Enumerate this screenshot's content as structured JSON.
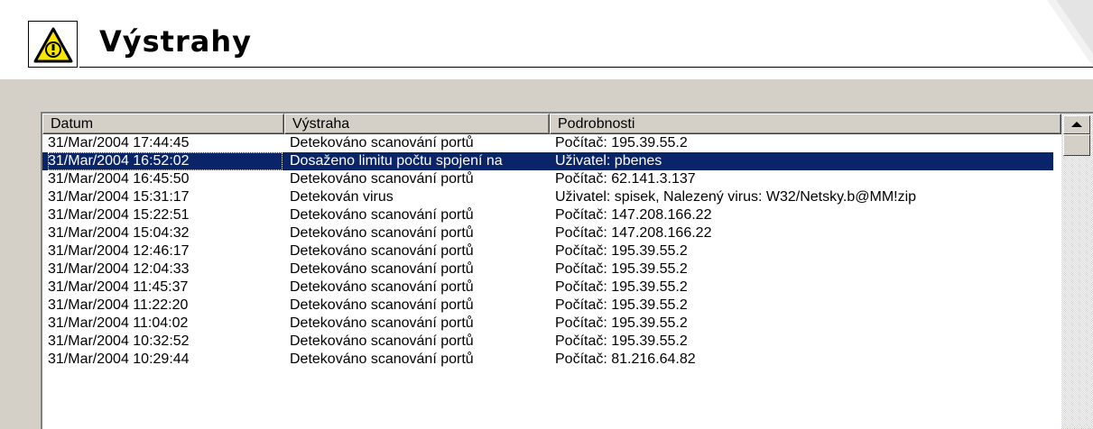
{
  "header": {
    "title": "Výstrahy",
    "icon": "warning-icon",
    "warning_color": "#f7e600"
  },
  "table": {
    "columns": [
      "Datum",
      "Výstraha",
      "Podrobnosti"
    ],
    "selected_index": 1,
    "selection_color": "#0a246a",
    "rows": [
      {
        "date": "31/Mar/2004 17:44:45",
        "alert": "Detekováno scanování portů",
        "details": "Počítač: 195.39.55.2"
      },
      {
        "date": "31/Mar/2004 16:52:02",
        "alert": "Dosaženo limitu počtu spojení na",
        "details": "Uživatel: pbenes"
      },
      {
        "date": "31/Mar/2004 16:45:50",
        "alert": "Detekováno scanování portů",
        "details": "Počítač: 62.141.3.137"
      },
      {
        "date": "31/Mar/2004 15:31:17",
        "alert": "Detekován virus",
        "details": "Uživatel: spisek, Nalezený virus: W32/Netsky.b@MM!zip"
      },
      {
        "date": "31/Mar/2004 15:22:51",
        "alert": "Detekováno scanování portů",
        "details": "Počítač: 147.208.166.22"
      },
      {
        "date": "31/Mar/2004 15:04:32",
        "alert": "Detekováno scanování portů",
        "details": "Počítač: 147.208.166.22"
      },
      {
        "date": "31/Mar/2004 12:46:17",
        "alert": "Detekováno scanování portů",
        "details": "Počítač: 195.39.55.2"
      },
      {
        "date": "31/Mar/2004 12:04:33",
        "alert": "Detekováno scanování portů",
        "details": "Počítač: 195.39.55.2"
      },
      {
        "date": "31/Mar/2004 11:45:37",
        "alert": "Detekováno scanování portů",
        "details": "Počítač: 195.39.55.2"
      },
      {
        "date": "31/Mar/2004 11:22:20",
        "alert": "Detekováno scanování portů",
        "details": "Počítač: 195.39.55.2"
      },
      {
        "date": "31/Mar/2004 11:04:02",
        "alert": "Detekováno scanování portů",
        "details": "Počítač: 195.39.55.2"
      },
      {
        "date": "31/Mar/2004 10:32:52",
        "alert": "Detekováno scanování portů",
        "details": "Počítač: 195.39.55.2"
      },
      {
        "date": "31/Mar/2004 10:29:44",
        "alert": "Detekováno scanování portů",
        "details": "Počítač: 81.216.64.82"
      }
    ]
  }
}
